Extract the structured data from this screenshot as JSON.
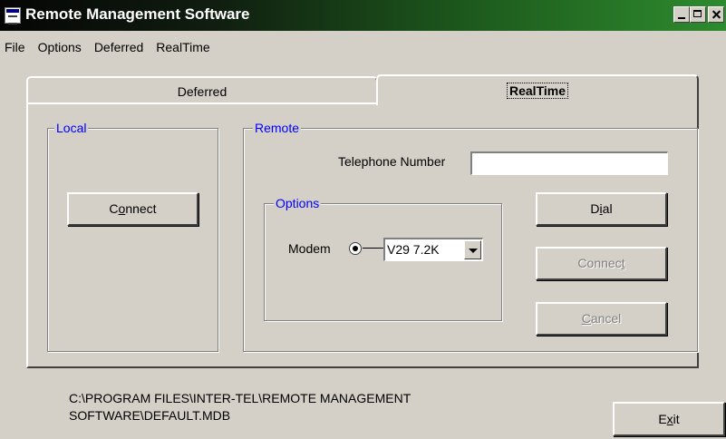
{
  "window": {
    "title": "Remote Management Software"
  },
  "menu": {
    "items": [
      "File",
      "Options",
      "Deferred",
      "RealTime"
    ]
  },
  "tabs": {
    "deferred": "Deferred",
    "realtime": "RealTime",
    "active": "RealTime"
  },
  "local": {
    "legend": "Local",
    "connect": {
      "pre": "C",
      "accel": "o",
      "post": "nnect"
    }
  },
  "remote": {
    "legend": "Remote",
    "telephone_label": "Telephone Number",
    "telephone_value": "",
    "options_legend": "Options",
    "modem_label": "Modem",
    "modem_value": "V29 7.2K",
    "dial": {
      "pre": "D",
      "accel": "i",
      "post": "al"
    },
    "connect": {
      "pre": "Connec",
      "accel": "t",
      "post": ""
    },
    "cancel": {
      "pre": "",
      "accel": "C",
      "post": "ancel"
    }
  },
  "status": {
    "path_line1": "C:\\PROGRAM FILES\\INTER-TEL\\REMOTE MANAGEMENT",
    "path_line2": "SOFTWARE\\DEFAULT.MDB"
  },
  "exit": {
    "pre": "E",
    "accel": "x",
    "post": "it"
  },
  "colors": {
    "legend": "#0000ff",
    "face": "#d4d0c8",
    "title_start": "#050505",
    "title_end": "#2e8b2e"
  }
}
